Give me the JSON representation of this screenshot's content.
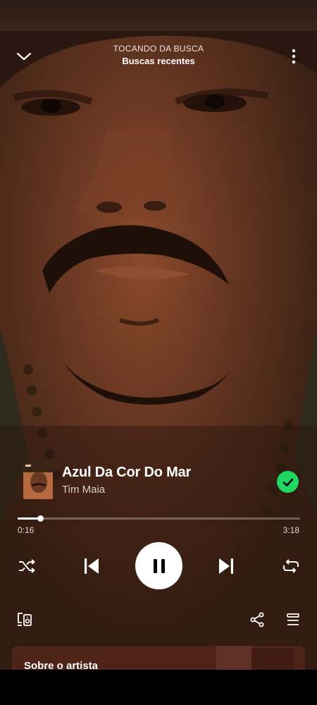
{
  "header": {
    "context_label": "TOCANDO DA BUSCA",
    "context_name": "Buscas recentes",
    "collapse_icon": "chevron-down-icon",
    "more_icon": "more-vertical-icon"
  },
  "track": {
    "title": "Azul Da Cor Do Mar",
    "artist": "Tim Maia",
    "liked": true
  },
  "playback": {
    "current_time": "0:16",
    "total_time": "3:18",
    "progress": 0.081,
    "is_playing": true
  },
  "controls": {
    "shuffle_icon": "shuffle-icon",
    "previous_icon": "skip-previous-icon",
    "play_pause_icon": "pause-icon",
    "next_icon": "skip-next-icon",
    "repeat_icon": "repeat-icon"
  },
  "footer": {
    "devices_icon": "connect-devices-icon",
    "share_icon": "share-icon",
    "queue_icon": "queue-icon"
  },
  "about": {
    "label": "Sobre o artista"
  },
  "colors": {
    "accent": "#1ed760",
    "background": "#4d2a1a"
  }
}
